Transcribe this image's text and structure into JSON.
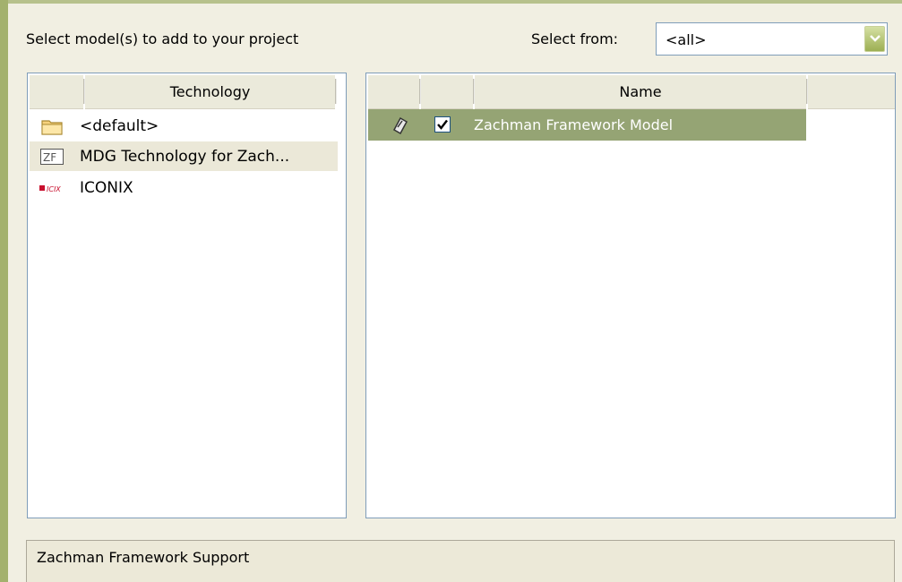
{
  "header": {
    "label": "Select model(s) to add to your project",
    "select_from_label": "Select from:",
    "select_from_value": "<all>"
  },
  "technology_panel": {
    "column_header": "Technology",
    "items": [
      {
        "label": "<default>",
        "icon": "folder-icon"
      },
      {
        "label": "MDG Technology for Zach...",
        "icon": "zf-technology-icon",
        "selected": true
      },
      {
        "label": "ICONIX",
        "icon": "iconix-icon"
      }
    ]
  },
  "models_panel": {
    "column_header": "Name",
    "items": [
      {
        "label": "Zachman Framework Model",
        "checked": true,
        "selected": true,
        "icon": "model-icon"
      }
    ]
  },
  "description": {
    "text": "Zachman Framework Support"
  },
  "colors": {
    "accent": "#95a474",
    "window_border": "#a3b16e",
    "panel_background": "#f1efe2"
  }
}
